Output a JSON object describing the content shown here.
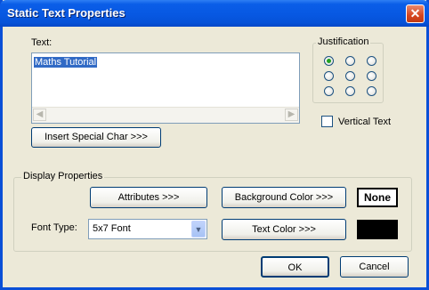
{
  "dialog": {
    "title": "Static Text Properties",
    "close_glyph": "✕"
  },
  "text_section": {
    "label": "Text:",
    "value": "Maths Tutorial",
    "scroll_left": "◀",
    "scroll_right": "▶",
    "insert_button": "Insert Special Char >>>"
  },
  "justification": {
    "title": "Justification",
    "selected": "top-left",
    "options": [
      "top-left",
      "top-center",
      "top-right",
      "middle-left",
      "middle-center",
      "middle-right",
      "bottom-left",
      "bottom-center",
      "bottom-right"
    ]
  },
  "vertical_text": {
    "label": "Vertical Text",
    "checked": false
  },
  "display_properties": {
    "title": "Display Properties",
    "attributes_button": "Attributes >>>",
    "background_color_button": "Background Color >>>",
    "background_swatch_label": "None",
    "background_swatch_color": "#ffffff",
    "font_type_label": "Font Type:",
    "font_type_value": "5x7 Font",
    "dropdown_glyph": "▼",
    "text_color_button": "Text Color >>>",
    "text_swatch_color": "#000000"
  },
  "footer": {
    "ok": "OK",
    "cancel": "Cancel"
  }
}
